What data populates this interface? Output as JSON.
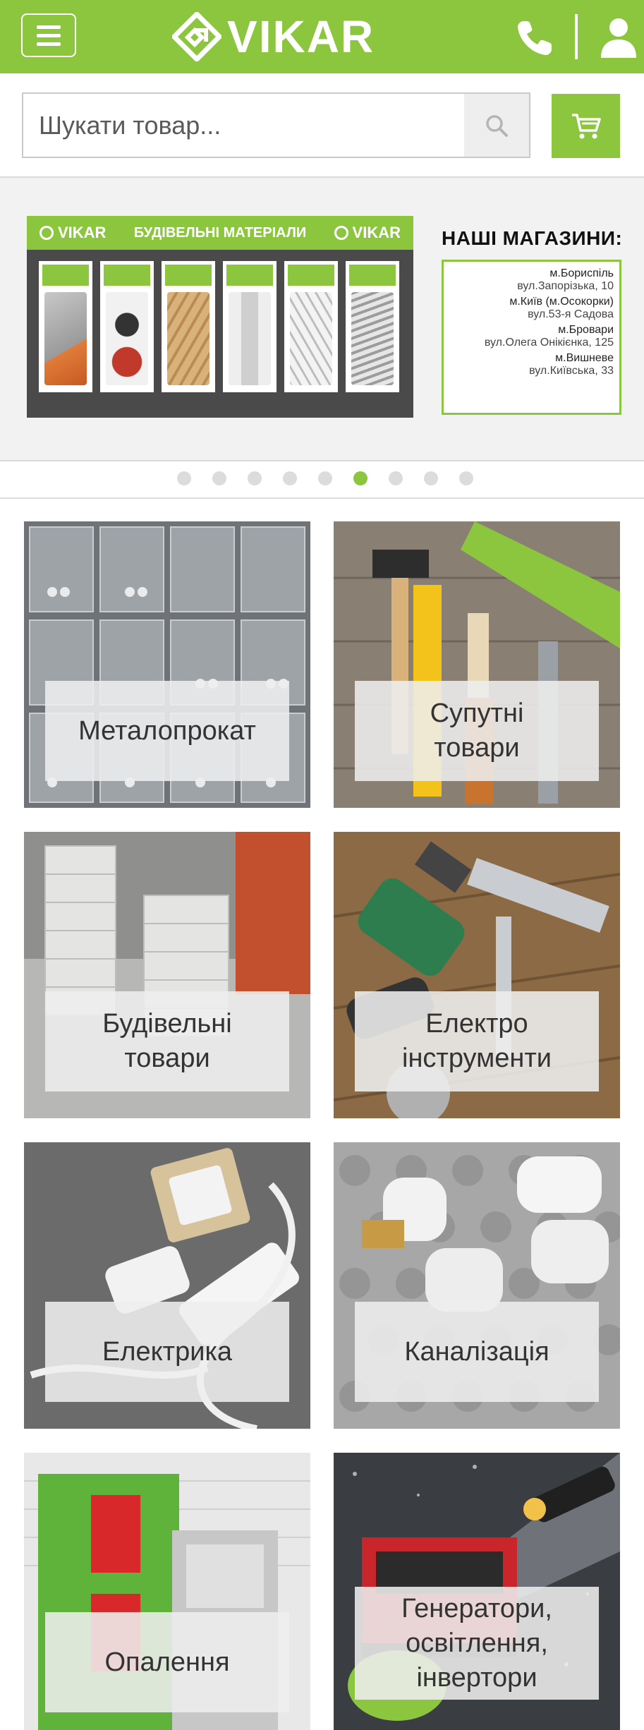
{
  "header": {
    "brand": "VIKAR",
    "menu_icon": "hamburger-menu-icon",
    "phone_icon": "phone-icon",
    "user_icon": "user-icon",
    "color": "#8cc63f"
  },
  "search": {
    "placeholder": "Шукати товар...",
    "value": "",
    "search_icon": "search-icon",
    "cart_icon": "cart-icon"
  },
  "banner": {
    "board_brand": "VIKAR",
    "board_title": "БУДІВЕЛЬНІ МАТЕРІАЛИ",
    "stores_title": "НАШІ МАГАЗИНИ:",
    "stores": [
      {
        "city": "м.Бориспіль",
        "address": "вул.Запорізька, 10"
      },
      {
        "city": "м.Київ (м.Осокорки)",
        "address": "вул.53-я Садова"
      },
      {
        "city": "м.Бровари",
        "address": "вул.Олега Онікієнка, 125"
      },
      {
        "city": "м.Вишневе",
        "address": "вул.Київська, 33"
      }
    ],
    "slide_count": 9,
    "active_slide": 6
  },
  "categories": [
    {
      "label": "Металопрокат"
    },
    {
      "label": "Супутні\nтовари"
    },
    {
      "label": "Будівельні\nтовари"
    },
    {
      "label": "Електро\nінструменти"
    },
    {
      "label": "Електрика"
    },
    {
      "label": "Каналізація"
    },
    {
      "label": "Опалення"
    },
    {
      "label": "Генератори,\nосвітлення,\nінвертори"
    }
  ]
}
